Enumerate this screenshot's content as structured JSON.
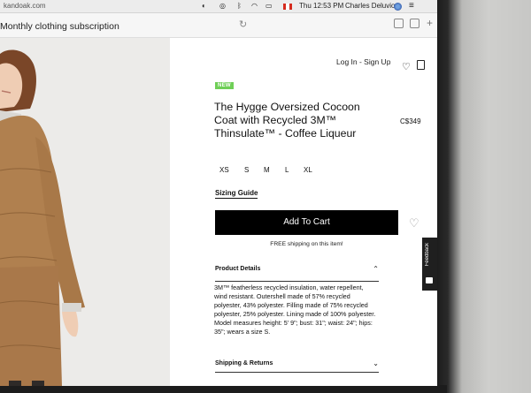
{
  "menubar": {
    "url_fragment": "kandoak.com",
    "time": "Thu 12:53 PM",
    "user": "Charles Deluvio"
  },
  "browser": {
    "tab_title": "Monthly clothing subscription"
  },
  "site_nav": {
    "login": "Log In - Sign Up"
  },
  "product": {
    "badge": "NEW",
    "title": "The Hygge Oversized Cocoon Coat with Recycled 3M™ Thinsulate™ - Coffee Liqueur",
    "price": "C$349",
    "sizes": [
      "XS",
      "S",
      "M",
      "L",
      "XL"
    ],
    "sizing_guide": "Sizing Guide",
    "add_to_cart": "Add To Cart",
    "free_shipping": "FREE shipping on this item!",
    "details_heading": "Product Details",
    "details_text": "3M™ featherless recycled insulation, water repellent, wind resistant. Outershell made of 57% recycled polyester, 43% polyester. Filling made of 75% recycled polyester, 25% polyester. Lining made of 100% polyester. Model measures height: 5' 9\"; bust: 31\"; waist: 24\"; hips: 35\"; wears a size S.",
    "shipping_heading": "Shipping & Returns"
  },
  "feedback": {
    "label": "Feedback"
  },
  "colors": {
    "coat": "#b0804f",
    "badge": "#6fcf57",
    "button": "#000000"
  }
}
